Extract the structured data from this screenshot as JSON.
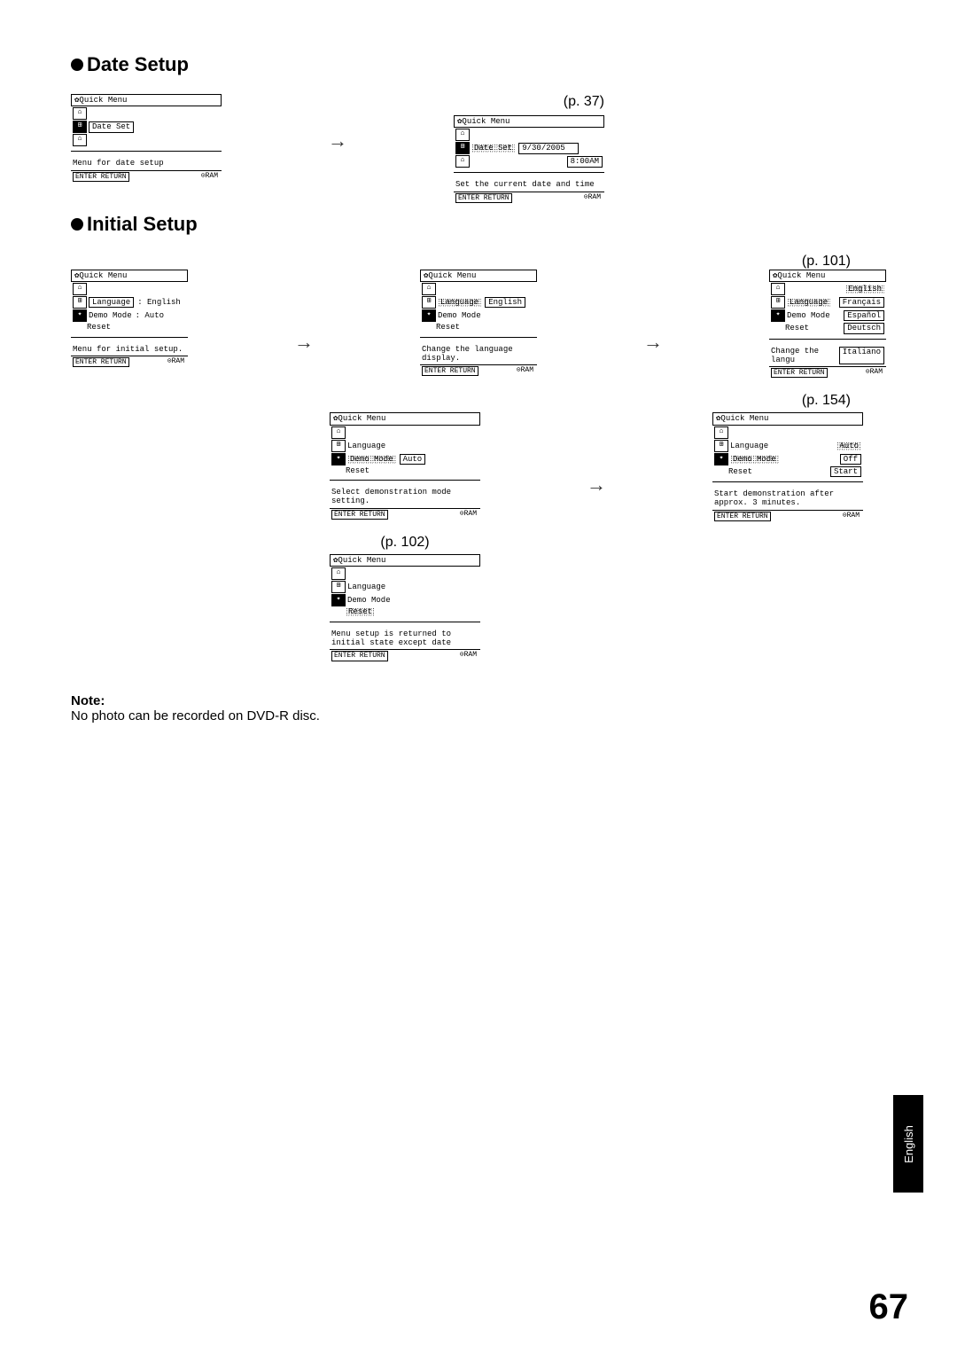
{
  "sections": {
    "date_setup": {
      "title": "Date Setup",
      "page_ref": "(p. 37)",
      "screen1": {
        "title": "Quick Menu",
        "item": "Date Set",
        "msg": "Menu for date setup",
        "foot_left": "ENTER  RETURN",
        "foot_right": "RAM"
      },
      "screen2": {
        "title": "Quick Menu",
        "item": "Date Set",
        "val1": "9/30/2005",
        "val2": "8:00AM",
        "msg": "Set the current date and time",
        "foot_left": "ENTER  RETURN",
        "foot_right": "RAM"
      }
    },
    "initial_setup": {
      "title": "Initial Setup",
      "page_ref_lang": "(p. 101)",
      "page_ref_demo": "(p. 154)",
      "page_ref_reset": "(p. 102)",
      "screen_main": {
        "title": "Quick Menu",
        "l1": "Language",
        "l1v": ": English",
        "l2": "Demo Mode",
        "l2v": ": Auto",
        "l3": "Reset",
        "msg": "Menu for initial setup.",
        "foot_left": "ENTER  RETURN",
        "foot_right": "RAM"
      },
      "screen_lang": {
        "title": "Quick Menu",
        "l1": "Language",
        "l1v": "English",
        "l2": "Demo Mode",
        "l3": "Reset",
        "msg": "Change the language display.",
        "foot_left": "ENTER  RETURN",
        "foot_right": "RAM"
      },
      "screen_langopts": {
        "title": "Quick Menu",
        "l1": "Language",
        "o1": "English",
        "l2": "Demo Mode",
        "o2": "Français",
        "o3": "Español",
        "l3": "Reset",
        "o4": "Deutsch",
        "msg": "Change the langu",
        "o5": "Italiano",
        "foot_left": "ENTER  RETURN",
        "foot_right": "RAM"
      },
      "screen_demo": {
        "title": "Quick Menu",
        "l1": "Language",
        "l2": "Demo Mode",
        "l2v": "Auto",
        "l3": "Reset",
        "msg": "Select demonstration mode setting.",
        "foot_left": "ENTER  RETURN",
        "foot_right": "RAM"
      },
      "screen_demoopts": {
        "title": "Quick Menu",
        "l1": "Language",
        "o1": "Auto",
        "l2": "Demo Mode",
        "o2": "Off",
        "l3": "Reset",
        "o3": "Start",
        "msg": "Start demonstration after approx. 3 minutes.",
        "foot_left": "ENTER  RETURN",
        "foot_right": "RAM"
      },
      "screen_reset": {
        "title": "Quick Menu",
        "l1": "Language",
        "l2": "Demo Mode",
        "l3": "Reset",
        "msg": "Menu setup is returned to initial state except date",
        "foot_left": "ENTER  RETURN",
        "foot_right": "RAM"
      }
    }
  },
  "note": {
    "label": "Note:",
    "body": "No photo can be recorded on DVD-R disc."
  },
  "tab": "English",
  "page_number": "67",
  "glyph": {
    "gear": "✿",
    "date": "⊞",
    "tool": "✦",
    "ram": "⊙"
  }
}
